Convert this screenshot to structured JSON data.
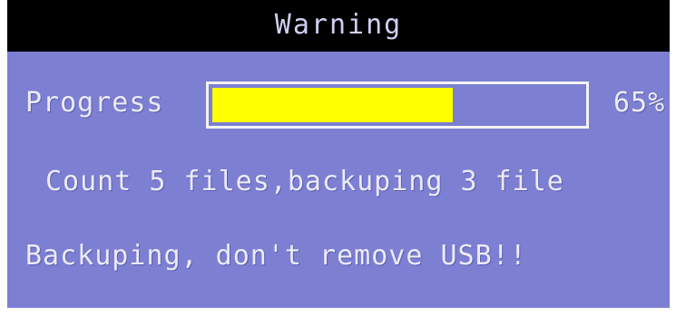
{
  "dialog": {
    "title": "Warning",
    "progress_label": "Progress",
    "progress_value": 0.65,
    "progress_text": "65%",
    "count_line": "Count 5 files,backuping 3 file",
    "warning_line": "Backuping, don't remove USB!!"
  },
  "colors": {
    "background": "#7c7fd2",
    "titlebar": "#000000",
    "progress_fill": "#ffff00",
    "progress_border": "#f2f2f2",
    "text": "#ecebf6"
  }
}
